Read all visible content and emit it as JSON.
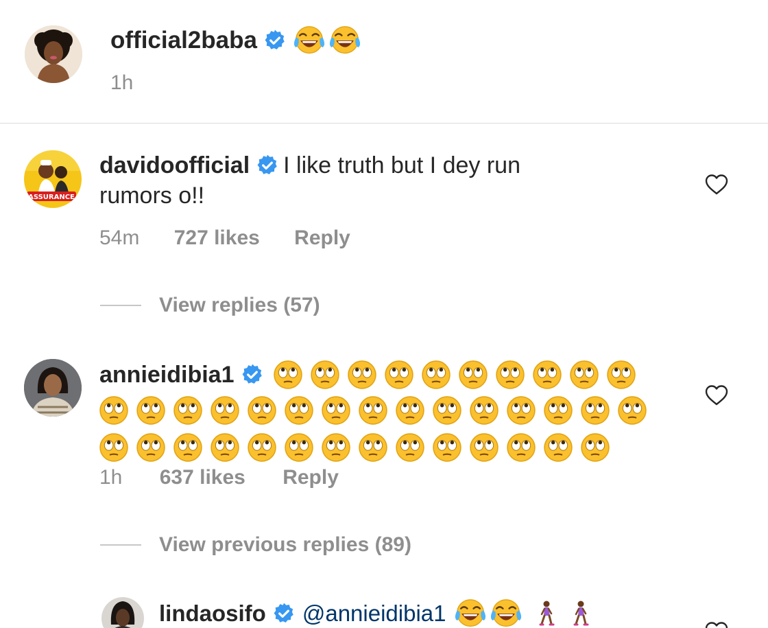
{
  "caption": {
    "username": "official2baba",
    "emojis": [
      "face-with-tears-of-joy",
      "face-with-tears-of-joy"
    ],
    "time": "1h"
  },
  "comments": [
    {
      "username": "davidoofficial",
      "text_line1": "I like truth but I dey run",
      "text_line2": "rumors o!!",
      "time": "54m",
      "likes": "727 likes",
      "reply": "Reply",
      "view_replies": "View replies (57)"
    },
    {
      "username": "annieidibia1",
      "emoji": "face-with-rolling-eyes",
      "emoji_rows": [
        10,
        15,
        14
      ],
      "time": "1h",
      "likes": "637 likes",
      "reply": "Reply",
      "view_replies": "View previous replies (89)"
    },
    {
      "username": "lindaosifo",
      "mention": "@annieidibia1",
      "emojis": [
        "face-with-tears-of-joy",
        "face-with-tears-of-joy",
        "person-walking",
        "person-walking"
      ]
    }
  ],
  "colors": {
    "text": "#262626",
    "muted": "#8e8e8e",
    "verified": "#3897f0",
    "divider": "#dbdbdb",
    "emoji_yellow": "#fbc02d"
  }
}
